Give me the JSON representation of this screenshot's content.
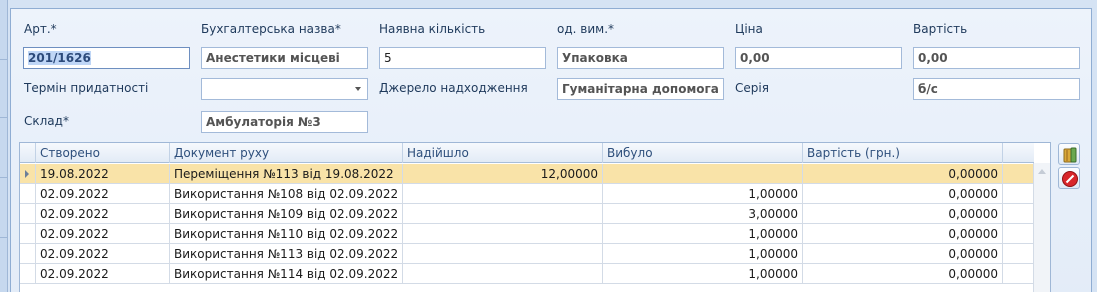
{
  "form": {
    "art": {
      "label": "Арт.*",
      "value": "201/1626"
    },
    "accounting_name": {
      "label": "Бухгалтерська назва*",
      "value": "Анестетики місцеві"
    },
    "quantity": {
      "label": "Наявна кількість",
      "value": "5"
    },
    "unit": {
      "label": "од. вим.*",
      "value": "Упаковка"
    },
    "price": {
      "label": "Ціна",
      "value": "0,00"
    },
    "cost": {
      "label": "Вартість",
      "value": "0,00"
    },
    "expiry": {
      "label": "Термін придатності",
      "value": ""
    },
    "source": {
      "label": "Джерело надходження",
      "value": "Гуманітарна допомога"
    },
    "series": {
      "label": "Серія",
      "value": "б/с"
    },
    "warehouse": {
      "label": "Склад*",
      "value": "Амбулаторія №3"
    }
  },
  "grid": {
    "columns": [
      "Створено",
      "Документ руху",
      "Надійшло",
      "Вибуло",
      "Вартість (грн.)"
    ],
    "rows": [
      {
        "created": "19.08.2022",
        "doc": "Переміщення №113 від 19.08.2022",
        "in": "12,00000",
        "out": "",
        "cost": "0,00000"
      },
      {
        "created": "02.09.2022",
        "doc": "Використання №108 від 02.09.2022",
        "in": "",
        "out": "1,00000",
        "cost": "0,00000"
      },
      {
        "created": "02.09.2022",
        "doc": "Використання №109 від 02.09.2022",
        "in": "",
        "out": "3,00000",
        "cost": "0,00000"
      },
      {
        "created": "02.09.2022",
        "doc": "Використання №110 від 02.09.2022",
        "in": "",
        "out": "1,00000",
        "cost": "0,00000"
      },
      {
        "created": "02.09.2022",
        "doc": "Використання №113 від 02.09.2022",
        "in": "",
        "out": "1,00000",
        "cost": "0,00000"
      },
      {
        "created": "02.09.2022",
        "doc": "Використання №114 від 02.09.2022",
        "in": "",
        "out": "1,00000",
        "cost": "0,00000"
      }
    ]
  },
  "icons": {
    "add": "book-add-icon",
    "delete": "delete-icon"
  },
  "colors": {
    "selected_row": "#f9e3a8",
    "label_text": "#1e395b",
    "panel_border": "#8fadd3"
  }
}
